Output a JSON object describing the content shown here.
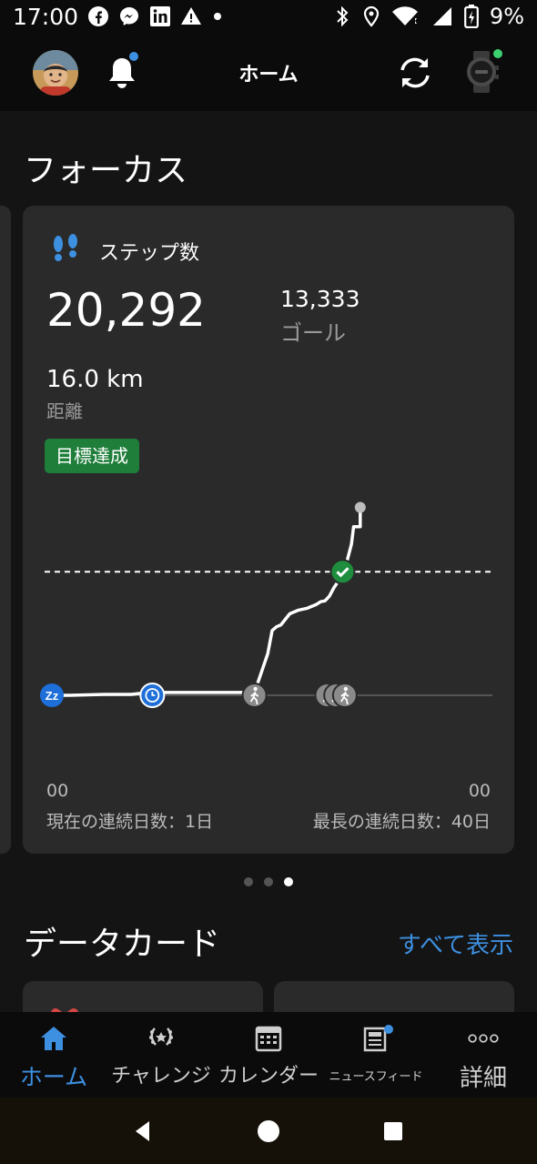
{
  "status_bar": {
    "time": "17:00",
    "battery": "9%",
    "left_icons": [
      "facebook-icon",
      "messenger-icon",
      "linkedin-icon",
      "warning-icon",
      "dot-icon"
    ],
    "right_icons": [
      "bluetooth-icon",
      "location-icon",
      "wifi-icon",
      "signal-icon",
      "battery-charging-icon"
    ]
  },
  "header": {
    "title": "ホーム",
    "notification_badge": true,
    "watch_connected": true
  },
  "focus": {
    "section_title": "フォーカス",
    "card": {
      "title": "ステップ数",
      "steps": "20,292",
      "goal_value": "13,333",
      "goal_label": "ゴール",
      "distance_value": "16.0 km",
      "distance_label": "距離",
      "badge": "目標達成",
      "axis_start": "00",
      "axis_end": "00",
      "current_streak": "現在の連続日数：1日",
      "longest_streak": "最長の連続日数：40日"
    },
    "pager": {
      "count": 3,
      "active": 2
    }
  },
  "chart_data": {
    "type": "line",
    "series": [
      {
        "x": [
          0,
          0.04,
          0.12,
          0.18,
          0.22,
          0.46,
          0.49,
          0.5,
          0.51,
          0.52,
          0.53,
          0.54,
          0.56,
          0.58,
          0.6,
          0.61,
          0.62,
          0.63,
          0.64,
          0.65,
          0.66,
          0.67,
          0.68,
          0.685,
          0.7,
          0.7
        ],
        "values": [
          0,
          0,
          100,
          100,
          300,
          300,
          4500,
          7000,
          7400,
          7600,
          8200,
          8800,
          9200,
          9400,
          9800,
          10100,
          10200,
          10700,
          11600,
          12300,
          13333,
          14500,
          16300,
          18200,
          18200,
          20292
        ]
      }
    ],
    "goal": 13333,
    "goal_marker": "check-circle-icon",
    "activity_markers": [
      "sleep-icon",
      "clock-icon",
      "walk-icon",
      "walk-icon",
      "walk-icon",
      "walk-icon"
    ],
    "colors": {
      "line": "#ffffff",
      "goal_line": "#ffffff",
      "goal_check": "#1e8e3e",
      "sleep": "#1e6fd9",
      "walk": "#8a8a8a"
    }
  },
  "data_cards": {
    "section_title": "データカード",
    "see_all": "すべて表示"
  },
  "bottom_nav": {
    "items": [
      {
        "label": "ホーム",
        "icon": "home-icon",
        "active": true
      },
      {
        "label": "チャレンジ",
        "icon": "laurel-icon",
        "active": false
      },
      {
        "label": "カレンダー",
        "icon": "calendar-icon",
        "active": false
      },
      {
        "label": "ニュースフィード",
        "icon": "newsfeed-icon",
        "active": false,
        "badge": true
      },
      {
        "label": "詳細",
        "icon": "more-icon",
        "active": false
      }
    ]
  },
  "system_nav": [
    "back-icon",
    "home-circle-icon",
    "recents-icon"
  ],
  "colors": {
    "accent": "#3d8fe0",
    "success": "#1e7e3a",
    "card_bg": "#2a2a2a",
    "bg": "#141414"
  }
}
